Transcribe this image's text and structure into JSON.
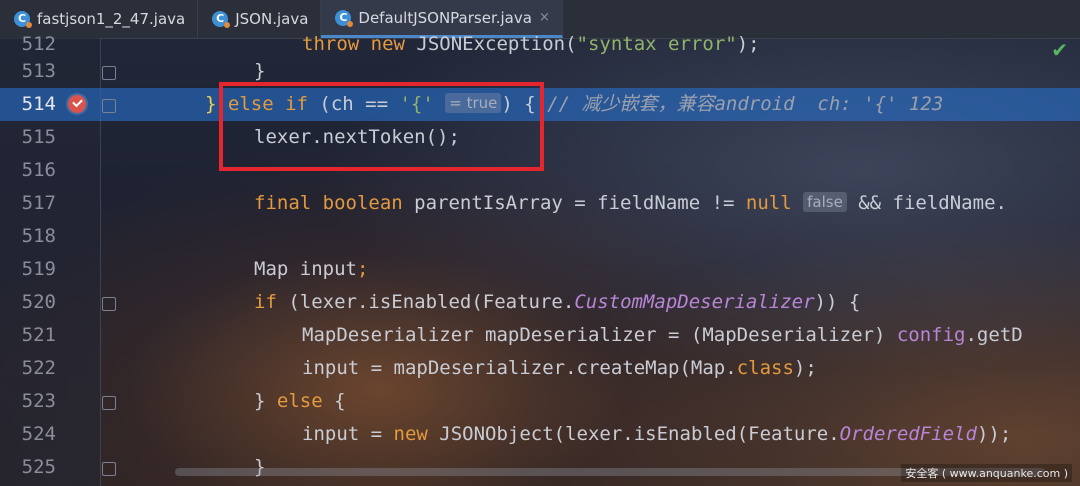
{
  "tabs": [
    {
      "label": "fastjson1_2_47.java",
      "icon": "java-class-icon"
    },
    {
      "label": "JSON.java",
      "icon": "java-class-icon"
    },
    {
      "label": "DefaultJSONParser.java",
      "icon": "java-class-icon",
      "active": true,
      "close": "×"
    }
  ],
  "status": {
    "check_glyph": "✔"
  },
  "lines": {
    "l512": {
      "num": "512",
      "t1": "throw new",
      "t2": " JSONException(",
      "t3": "\"syntax error\"",
      "t4": ");"
    },
    "l513": {
      "num": "513",
      "t1": "}"
    },
    "l514": {
      "num": "514",
      "t1": "}",
      "t2": " else if",
      "t3": " (ch == ",
      "t4": "'{'",
      "inlay": "= true",
      "t5": ") { ",
      "t6": "// 减少嵌套，兼容android  ch: '{' 123"
    },
    "l515": {
      "num": "515",
      "t1": "lexer.nextToken();"
    },
    "l516": {
      "num": "516"
    },
    "l517": {
      "num": "517",
      "t1": "final boolean",
      "t2": " parentIsArray = fieldName != ",
      "t3": "null",
      "inlay": "false",
      "t4": " && fieldName."
    },
    "l518": {
      "num": "518"
    },
    "l519": {
      "num": "519",
      "t1": "Map input",
      "t2": ";"
    },
    "l520": {
      "num": "520",
      "t1": "if",
      "t2": " (lexer.isEnabled(Feature.",
      "t3": "CustomMapDeserializer",
      "t4": ")) {"
    },
    "l521": {
      "num": "521",
      "t1": "MapDeserializer mapDeserializer = (MapDeserializer) ",
      "t2": "config",
      "t3": ".getD"
    },
    "l522": {
      "num": "522",
      "t1": "input = mapDeserializer.createMap(Map.",
      "t2": "class",
      "t3": ");"
    },
    "l523": {
      "num": "523",
      "t1": "} ",
      "t2": "else",
      "t3": " {"
    },
    "l524": {
      "num": "524",
      "t1": "input = ",
      "t2": "new",
      "t3": " JSONObject(lexer.isEnabled(Feature.",
      "t4": "OrderedField",
      "t5": "));"
    },
    "l525": {
      "num": "525",
      "t1": "}"
    }
  },
  "watermark": "安全客 ( www.anquanke.com )"
}
